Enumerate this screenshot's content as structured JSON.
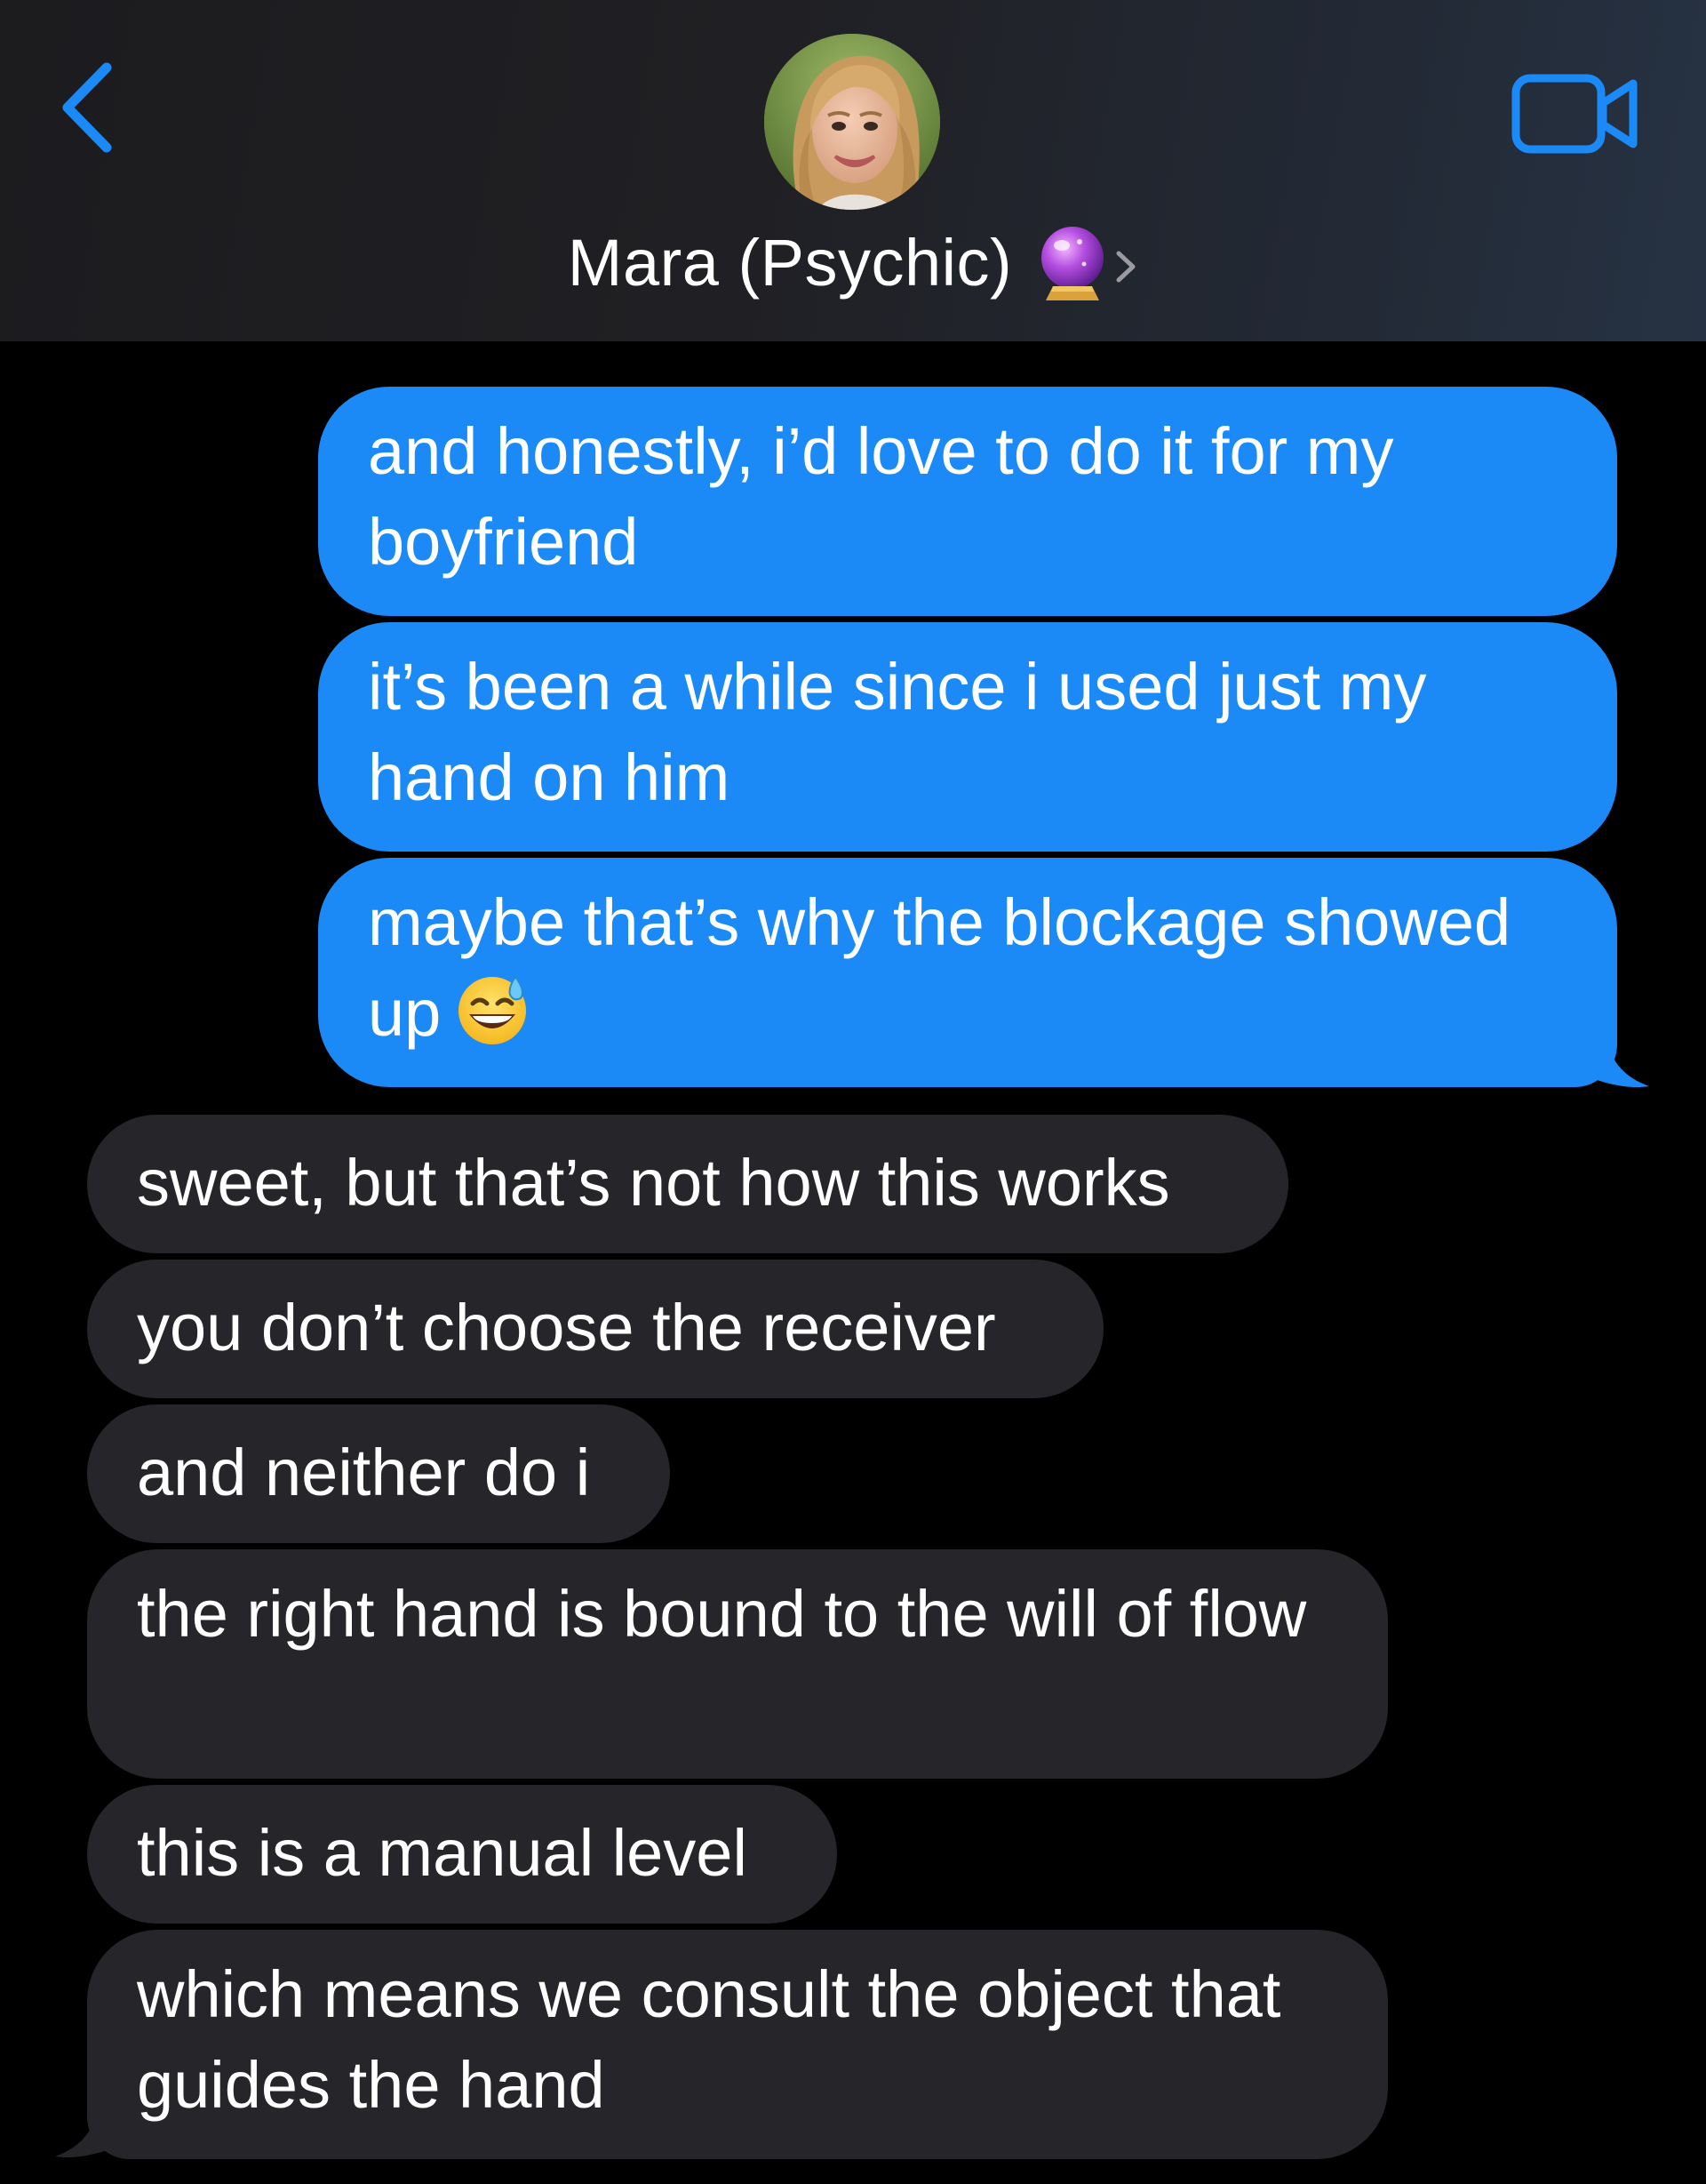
{
  "header": {
    "contact_name": "Mara (Psychic)",
    "contact_emoji": "crystal-ball",
    "back_icon": "chevron-left-icon",
    "video_icon": "video-camera-icon",
    "accent_color": "#1b8af6"
  },
  "messages": [
    {
      "direction": "sent",
      "text": "and honestly, i’d love to do it for my boyfriend"
    },
    {
      "direction": "sent",
      "text": "it’s been a while since i used just my hand on him"
    },
    {
      "direction": "sent",
      "text": "maybe that’s why the blockage showed up",
      "emoji": "grinning-face-with-sweat"
    },
    {
      "direction": "received",
      "text": "sweet, but that’s not how this works"
    },
    {
      "direction": "received",
      "text": "you don’t choose the receiver"
    },
    {
      "direction": "received",
      "text": "and neither do i"
    },
    {
      "direction": "received",
      "text": "the right hand is bound to the will of flow"
    },
    {
      "direction": "received",
      "text": "this is a manual level"
    },
    {
      "direction": "received",
      "text": "which means we consult the object that guides the hand"
    }
  ],
  "colors": {
    "sent_bubble": "#1b8af6",
    "received_bubble": "#26262a",
    "background": "#000000"
  }
}
